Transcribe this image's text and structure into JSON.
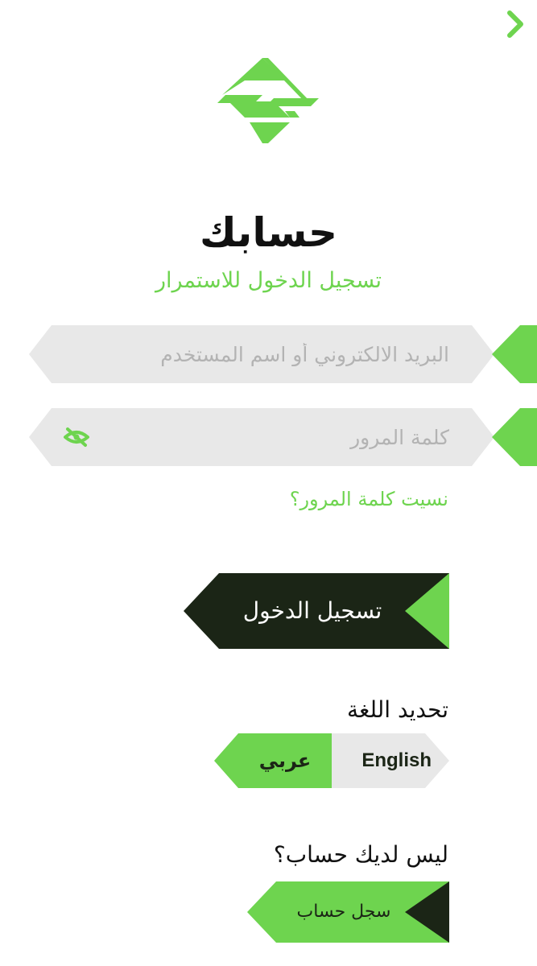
{
  "header": {
    "back_icon": "chevron-right-icon",
    "logo_icon": "brand-logo-icon"
  },
  "hero": {
    "title": "حسابك",
    "subtitle": "تسجيل الدخول للاستمرار"
  },
  "form": {
    "username_placeholder": "البريد الالكتروني أو اسم المستخدم",
    "username_value": "",
    "password_placeholder": "كلمة المرور",
    "password_value": "",
    "password_toggle_icon": "eye-slash-icon",
    "forgot_password": "نسيت كلمة المرور؟",
    "login_label": "تسجيل الدخول"
  },
  "language": {
    "heading": "تحديد اللغة",
    "options": [
      "عربي",
      "English"
    ],
    "selected": "عربي"
  },
  "register": {
    "heading": "ليس لديك حساب؟",
    "button_label": "سجل حساب"
  },
  "colors": {
    "accent": "#6ed44f",
    "dark": "#1b2516",
    "field_bg": "#e8e8e8"
  }
}
